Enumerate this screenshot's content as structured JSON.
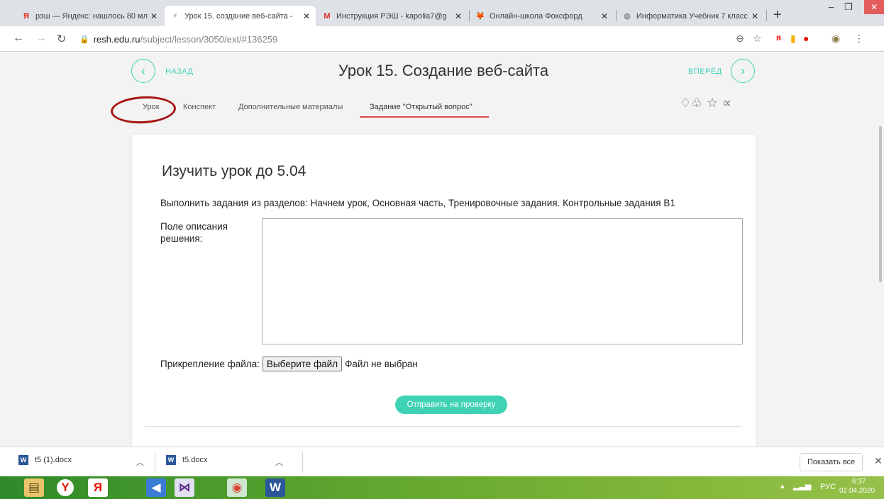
{
  "browser": {
    "tabs": [
      {
        "title": "рэш — Яндекс: нашлось 80 мл",
        "icon": "yandex-icon",
        "close": "✕",
        "active": false
      },
      {
        "title": "Урок 15. создание веб-сайта -",
        "icon": "resh-icon",
        "close": "✕",
        "active": true
      },
      {
        "title": "Инструкция РЭШ - kapolia7@g",
        "icon": "gmail-icon",
        "close": "✕",
        "active": false
      },
      {
        "title": "Онлайн-школа Фоксфорд",
        "icon": "foxford-icon",
        "close": "✕",
        "active": false
      },
      {
        "title": "Информатика Учебник 7 класс",
        "icon": "globe-icon",
        "close": "✕",
        "active": false
      }
    ],
    "new_tab": "+",
    "window_controls": {
      "minimize": "–",
      "restore": "❐",
      "close": "✕"
    },
    "url": {
      "host": "resh.edu.ru",
      "path": "/subject/lesson/3050/ext/#136259"
    }
  },
  "lesson": {
    "back_label": "НАЗАД",
    "forward_label": "ВПЕРЁД",
    "title": "Урок 15. Создание веб-сайта",
    "tabs": [
      {
        "label": "Урок"
      },
      {
        "label": "Конспект"
      },
      {
        "label": "Дополнительные материалы"
      },
      {
        "label": "Задание \"Открытый вопрос\""
      }
    ],
    "active_tab": "Задание \"Открытый вопрос\""
  },
  "task": {
    "heading": "Изучить урок до 5.04",
    "description": "Выполнить задания из разделов: Начнем урок, Основная часть, Тренировочные задания. Контрольные задания В1",
    "solution_label": "Поле описания решения:",
    "solution_value": "",
    "attach_label": "Прикрепление файла:",
    "choose_file_button": "Выберите файл",
    "no_file_text": "Файл не выбран",
    "submit_button": "Отправить на проверку"
  },
  "downloads": {
    "items": [
      {
        "name": "t5 (1).docx"
      },
      {
        "name": "t5.docx"
      }
    ],
    "show_all": "Показать все"
  },
  "taskbar": {
    "lang": "РУС",
    "time": "6:37",
    "date": "02.04.2020"
  },
  "colors": {
    "accent": "#3fd2b4",
    "active_tab_underline": "#e04848",
    "annotation_ellipse": "#a81515"
  }
}
